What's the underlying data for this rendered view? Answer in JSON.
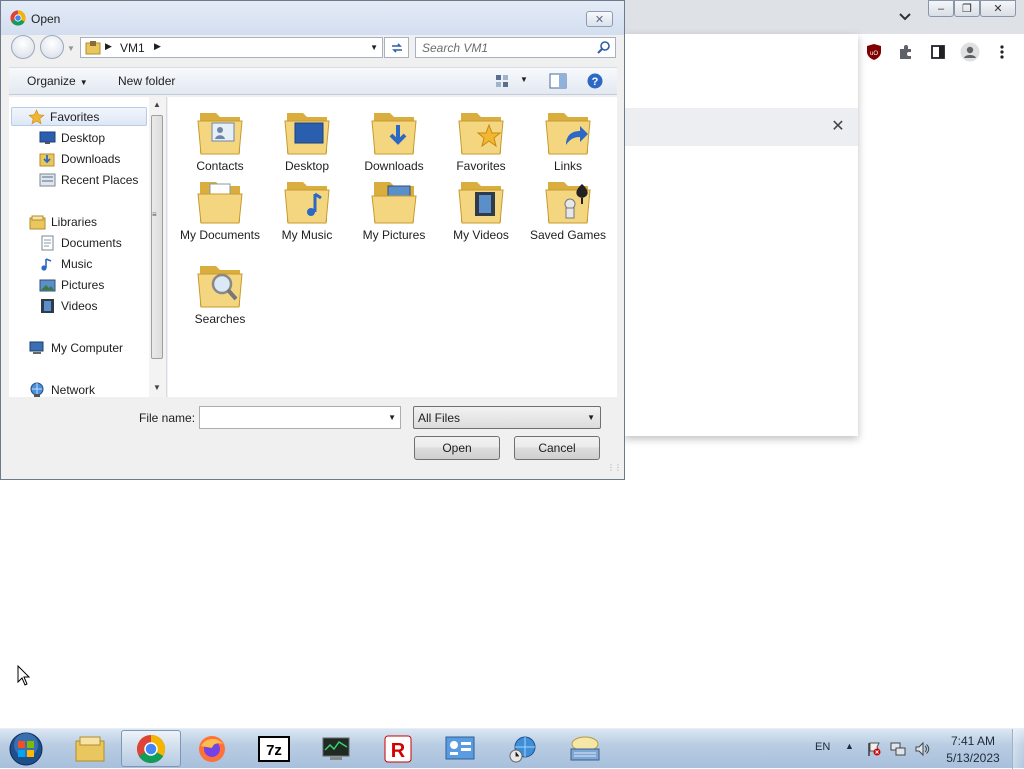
{
  "dialog": {
    "title": "Open",
    "address": {
      "crumbs": [
        "VM1"
      ]
    },
    "search_placeholder": "Search VM1",
    "toolbar": {
      "organize": "Organize",
      "new_folder": "New folder"
    },
    "nav": {
      "favorites": "Favorites",
      "favorites_items": [
        "Desktop",
        "Downloads",
        "Recent Places"
      ],
      "libraries": "Libraries",
      "libraries_items": [
        "Documents",
        "Music",
        "Pictures",
        "Videos"
      ],
      "computer": "My Computer",
      "network": "Network"
    },
    "folders": [
      {
        "label": "Contacts",
        "icon": "contacts-folder-icon"
      },
      {
        "label": "Desktop",
        "icon": "desktop-folder-icon"
      },
      {
        "label": "Downloads",
        "icon": "downloads-folder-icon"
      },
      {
        "label": "Favorites",
        "icon": "favorites-folder-icon"
      },
      {
        "label": "Links",
        "icon": "links-folder-icon"
      },
      {
        "label": "My Documents",
        "icon": "documents-folder-icon"
      },
      {
        "label": "My Music",
        "icon": "music-folder-icon"
      },
      {
        "label": "My Pictures",
        "icon": "pictures-folder-icon"
      },
      {
        "label": "My Videos",
        "icon": "videos-folder-icon"
      },
      {
        "label": "Saved Games",
        "icon": "saved-games-folder-icon"
      },
      {
        "label": "Searches",
        "icon": "searches-folder-icon"
      }
    ],
    "file_name_label": "File name:",
    "file_name_value": "",
    "file_type": "All Files",
    "open_button": "Open",
    "cancel_button": "Cancel"
  },
  "taskbar": {
    "pinned": [
      "windows-explorer",
      "google-chrome",
      "firefox",
      "7-zip",
      "system-monitor",
      "roblox",
      "control-panel",
      "network-globe",
      "keyboard"
    ],
    "language": "EN",
    "time": "7:41 AM",
    "date": "5/13/2023"
  },
  "colors": {
    "accent_star": "#1a73e8",
    "selection": "#dde7f5",
    "taskbar": "#b9cde3",
    "folder": "#f2d27a"
  }
}
